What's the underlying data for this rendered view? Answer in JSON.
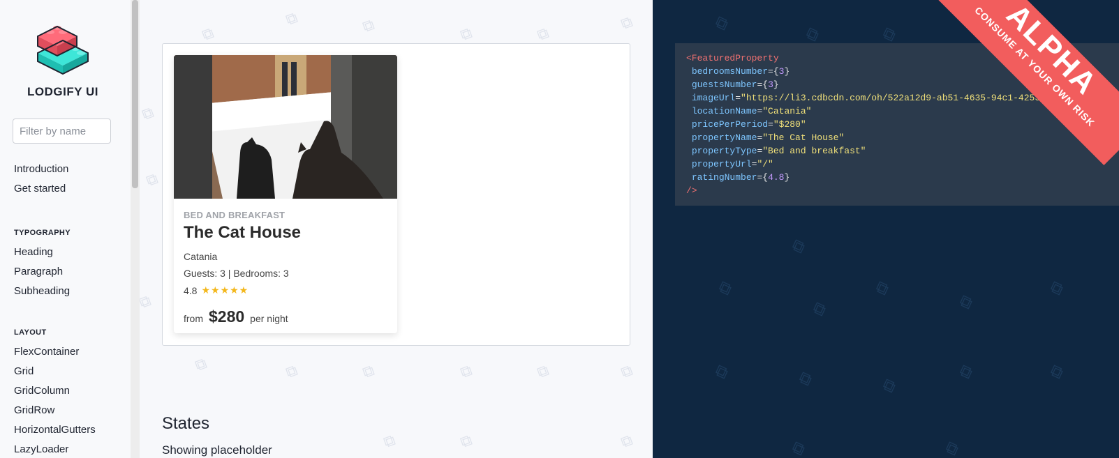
{
  "brand": {
    "name": "LODGIFY UI"
  },
  "filter": {
    "placeholder": "Filter by name"
  },
  "nav": {
    "top": [
      "Introduction",
      "Get started"
    ],
    "typography_heading": "TYPOGRAPHY",
    "typography": [
      "Heading",
      "Paragraph",
      "Subheading"
    ],
    "layout_heading": "LAYOUT",
    "layout": [
      "FlexContainer",
      "Grid",
      "GridColumn",
      "GridRow",
      "HorizontalGutters",
      "LazyLoader"
    ]
  },
  "card": {
    "type": "BED AND BREAKFAST",
    "name": "The Cat House",
    "location": "Catania",
    "meta": "Guests: 3 | Bedrooms: 3",
    "rating": "4.8",
    "stars": "★★★★★",
    "from": "from",
    "price": "$280",
    "per": "per night"
  },
  "states": {
    "heading": "States",
    "subheading": "Showing placeholder"
  },
  "code": {
    "open_tag": "<FeaturedProperty",
    "attrs": [
      {
        "name": "bedroomsNumber",
        "kind": "num",
        "value": "3"
      },
      {
        "name": "guestsNumber",
        "kind": "num",
        "value": "3"
      },
      {
        "name": "imageUrl",
        "kind": "str",
        "value": "\"https://li3.cdbcdn.com/oh/522a12d9-ab51-4635-94c1-42536f286e4d.jpg"
      },
      {
        "name": "locationName",
        "kind": "str",
        "value": "\"Catania\""
      },
      {
        "name": "pricePerPeriod",
        "kind": "str",
        "value": "\"$280\""
      },
      {
        "name": "propertyName",
        "kind": "str",
        "value": "\"The Cat House\""
      },
      {
        "name": "propertyType",
        "kind": "str",
        "value": "\"Bed and breakfast\""
      },
      {
        "name": "propertyUrl",
        "kind": "str",
        "value": "\"/\""
      },
      {
        "name": "ratingNumber",
        "kind": "num",
        "value": "4.8"
      }
    ],
    "close_tag": "/>"
  },
  "ribbon": {
    "big": "ALPHA",
    "small": "CONSUME AT YOUR OWN RISK"
  },
  "colors": {
    "accent_red": "#f25d5d",
    "code_bg": "#0f2741",
    "star": "#f3b71b"
  }
}
